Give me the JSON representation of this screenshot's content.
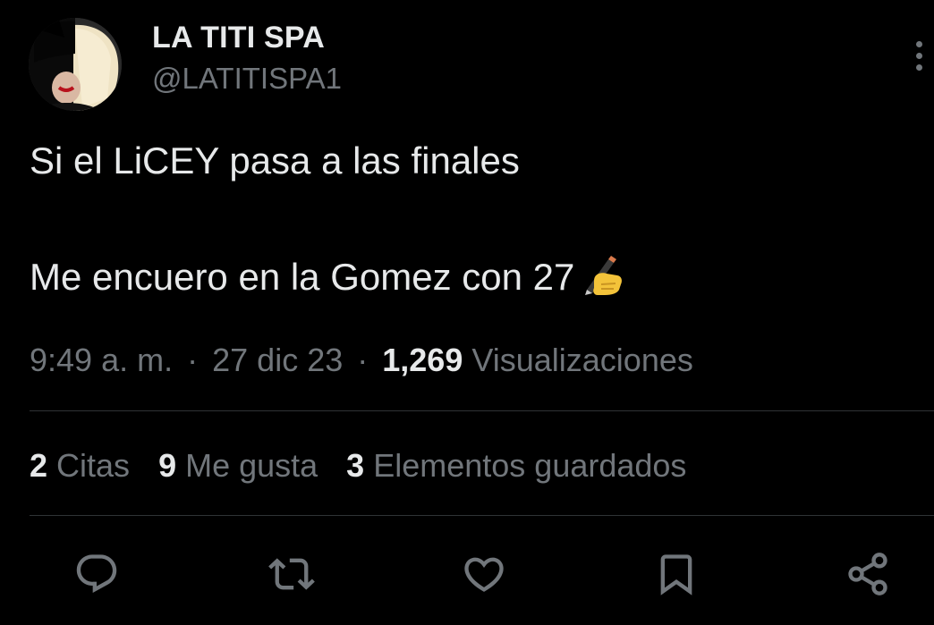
{
  "author": {
    "display_name": "LA TITI SPA",
    "handle": "@LATITISPA1",
    "avatar_icon": "avatar-blonde-black-hair"
  },
  "tweet": {
    "lines": [
      "Si el LiCEY pasa a las finales",
      "Me encuero en la Gomez con 27"
    ],
    "emoji": "writing-hand-emoji"
  },
  "meta": {
    "time": "9:49 a. m.",
    "separator": "·",
    "date": "27 dic 23",
    "views_count": "1,269",
    "views_label": "Visualizaciones"
  },
  "stats": {
    "quotes_count": "2",
    "quotes_label": "Citas",
    "likes_count": "9",
    "likes_label": "Me gusta",
    "bookmarks_count": "3",
    "bookmarks_label": "Elementos guardados"
  },
  "actions": [
    "reply-icon",
    "retweet-icon",
    "like-icon",
    "bookmark-icon",
    "share-icon"
  ],
  "colors": {
    "background": "#000000",
    "primary_text": "#e7e9ea",
    "secondary_text": "#71767b",
    "divider": "#2f3336"
  }
}
